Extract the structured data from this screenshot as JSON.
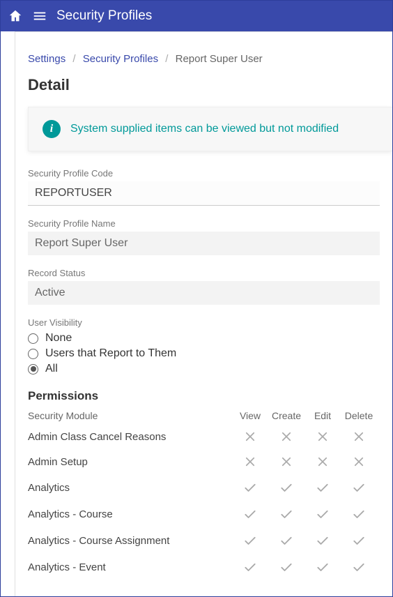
{
  "header": {
    "title": "Security Profiles"
  },
  "breadcrumb": {
    "items": [
      {
        "label": "Settings",
        "link": true
      },
      {
        "label": "Security Profiles",
        "link": true
      },
      {
        "label": "Report Super User",
        "link": false
      }
    ]
  },
  "detail_heading": "Detail",
  "banner": {
    "icon_glyph": "i",
    "text": "System supplied items can be viewed but not modified"
  },
  "fields": {
    "code": {
      "label": "Security Profile Code",
      "value": "REPORTUSER"
    },
    "name": {
      "label": "Security Profile Name",
      "value": "Report Super User"
    },
    "status": {
      "label": "Record Status",
      "value": "Active"
    }
  },
  "visibility": {
    "label": "User Visibility",
    "options": [
      "None",
      "Users that Report to Them",
      "All"
    ],
    "selected": "All"
  },
  "permissions": {
    "heading": "Permissions",
    "columns": [
      "Security Module",
      "View",
      "Create",
      "Edit",
      "Delete"
    ],
    "rows": [
      {
        "module": "Admin Class Cancel Reasons",
        "perms": [
          false,
          false,
          false,
          false
        ]
      },
      {
        "module": "Admin Setup",
        "perms": [
          false,
          false,
          false,
          false
        ]
      },
      {
        "module": "Analytics",
        "perms": [
          true,
          true,
          true,
          true
        ]
      },
      {
        "module": "Analytics - Course",
        "perms": [
          true,
          true,
          true,
          true
        ]
      },
      {
        "module": "Analytics - Course Assignment",
        "perms": [
          true,
          true,
          true,
          true
        ]
      },
      {
        "module": "Analytics - Event",
        "perms": [
          true,
          true,
          true,
          true
        ]
      }
    ]
  },
  "icons": {
    "home": "home-icon",
    "menu": "menu-icon",
    "info": "info-icon",
    "check": "check-icon",
    "cross": "cross-icon"
  }
}
